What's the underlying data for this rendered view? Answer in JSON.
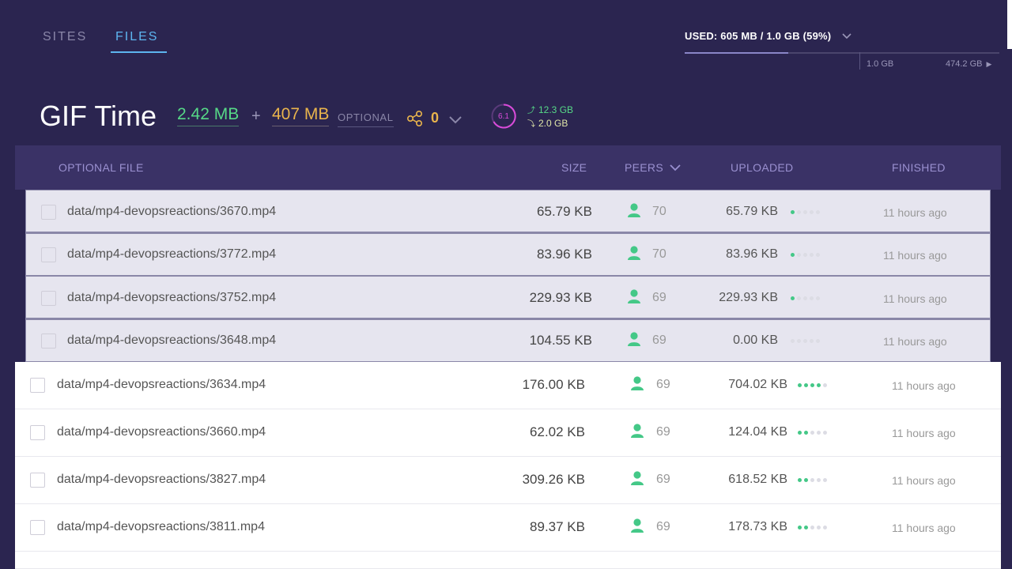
{
  "nav": {
    "tabs": [
      {
        "label": "SITES"
      },
      {
        "label": "FILES",
        "active": true
      }
    ]
  },
  "usage": {
    "label": "USED: 605 MB / 1.0 GB (59%)",
    "fill_percent": 59,
    "left_label": "1.0 GB",
    "right_label": "474.2 GB"
  },
  "site": {
    "title": "GIF Time",
    "size": "2.42 MB",
    "plus": "+",
    "optional_size": "407 MB",
    "optional_label": "OPTIONAL",
    "share_count": "0",
    "ring_value": "6.1",
    "upload": "12.3 GB",
    "download": "2.0 GB"
  },
  "table": {
    "headers": {
      "file": "OPTIONAL FILE",
      "size": "SIZE",
      "peers": "PEERS",
      "uploaded": "UPLOADED",
      "finished": "FINISHED"
    },
    "rows": [
      {
        "name": "data/mp4-devopsreactions/3670.mp4",
        "size": "65.79 KB",
        "peers": "70",
        "uploaded": "65.79 KB",
        "ratio_dots": 1,
        "finished": "11 hours ago"
      },
      {
        "name": "data/mp4-devopsreactions/3772.mp4",
        "size": "83.96 KB",
        "peers": "70",
        "uploaded": "83.96 KB",
        "ratio_dots": 1,
        "finished": "11 hours ago"
      },
      {
        "name": "data/mp4-devopsreactions/3752.mp4",
        "size": "229.93 KB",
        "peers": "69",
        "uploaded": "229.93 KB",
        "ratio_dots": 1,
        "finished": "11 hours ago"
      },
      {
        "name": "data/mp4-devopsreactions/3648.mp4",
        "size": "104.55 KB",
        "peers": "69",
        "uploaded": "0.00 KB",
        "ratio_dots": 0,
        "finished": "11 hours ago"
      },
      {
        "name": "data/mp4-devopsreactions/3634.mp4",
        "size": "176.00 KB",
        "peers": "69",
        "uploaded": "704.02 KB",
        "ratio_dots": 4,
        "finished": "11 hours ago"
      },
      {
        "name": "data/mp4-devopsreactions/3660.mp4",
        "size": "62.02 KB",
        "peers": "69",
        "uploaded": "124.04 KB",
        "ratio_dots": 2,
        "finished": "11 hours ago"
      },
      {
        "name": "data/mp4-devopsreactions/3827.mp4",
        "size": "309.26 KB",
        "peers": "69",
        "uploaded": "618.52 KB",
        "ratio_dots": 2,
        "finished": "11 hours ago"
      },
      {
        "name": "data/mp4-devopsreactions/3811.mp4",
        "size": "89.37 KB",
        "peers": "69",
        "uploaded": "178.73 KB",
        "ratio_dots": 2,
        "finished": "11 hours ago"
      }
    ]
  },
  "colors": {
    "background": "#2b2550",
    "accent_blue": "#5db5f0",
    "green": "#56d987",
    "orange": "#e9b44c",
    "ring": "#d94bd9"
  },
  "icons": [
    "share-icon",
    "chevron-down-icon",
    "peer-user-icon",
    "checkbox-icon"
  ]
}
